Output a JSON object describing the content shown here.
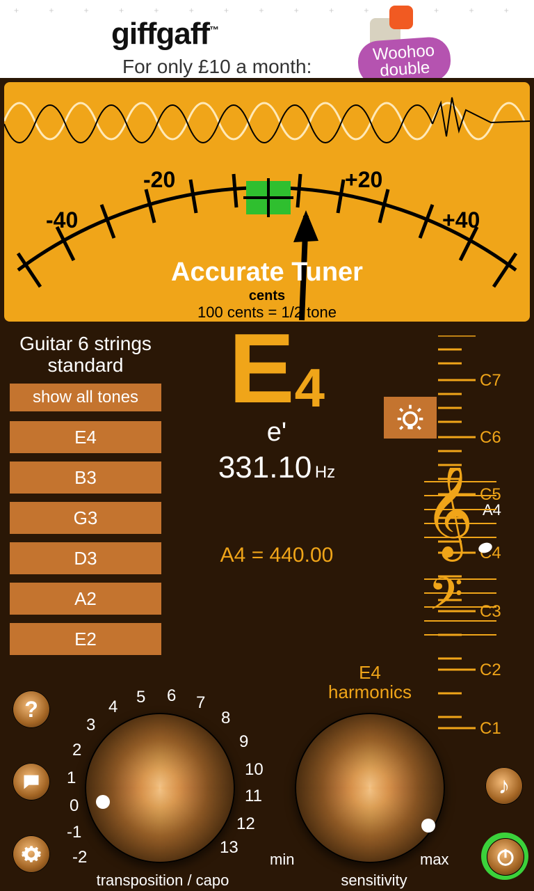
{
  "ad": {
    "brand": "giffgaff",
    "tm": "™",
    "tagline": "For only £10 a month:",
    "badge_line1": "Woohoo",
    "badge_line2": "double"
  },
  "meter": {
    "app_title": "Accurate Tuner",
    "cents_label": "cents",
    "cents_explain": "100 cents = 1/2 tone",
    "scale_labels": {
      "m40": "-40",
      "m20": "-20",
      "p20": "+20",
      "p40": "+40"
    },
    "needle_cents": 10
  },
  "instrument": {
    "title_line1": "Guitar 6 strings",
    "title_line2": "standard",
    "show_all": "show all tones",
    "strings": [
      "E4",
      "B3",
      "G3",
      "D3",
      "A2",
      "E2"
    ]
  },
  "readout": {
    "note_letter": "E",
    "note_octave": "4",
    "solfege": "e'",
    "freq_value": "331.10",
    "freq_unit": "Hz",
    "a4_line": "A4 = 440.00"
  },
  "right_scale": {
    "labels": [
      "C7",
      "C6",
      "C5",
      "C4",
      "C3",
      "C2",
      "C1"
    ],
    "a4_label": "A4"
  },
  "harmonics": {
    "note": "E4",
    "word": "harmonics"
  },
  "transposition": {
    "label": "transposition / capo",
    "marks": [
      "0",
      "1",
      "2",
      "3",
      "4",
      "5",
      "6",
      "7",
      "8",
      "9",
      "10",
      "11",
      "12",
      "13",
      "-1",
      "-2"
    ],
    "value": 0
  },
  "sensitivity": {
    "label": "sensitivity",
    "min": "min",
    "max": "max",
    "value": "max"
  },
  "colors": {
    "accent": "#f0a519",
    "button": "#c4742f",
    "in_tune": "#2fbf2f"
  }
}
